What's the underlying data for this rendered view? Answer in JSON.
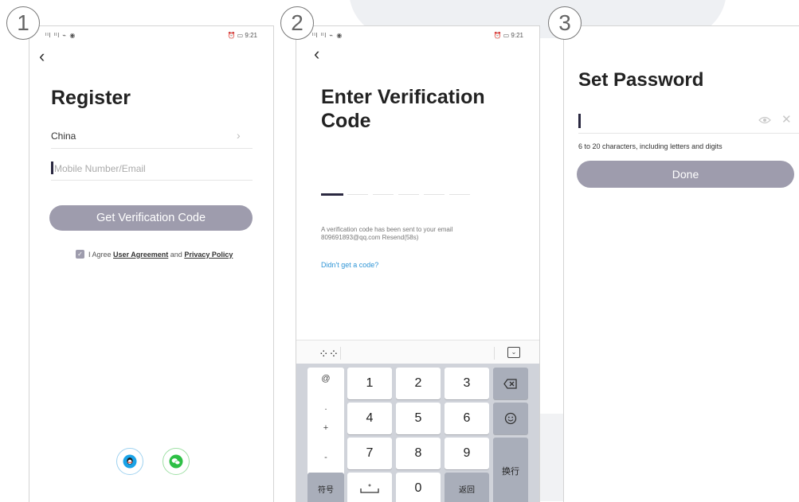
{
  "steps": [
    "1",
    "2",
    "3"
  ],
  "status": {
    "left": "ᴵᴵl ᴵᴵl ⌁ ◉",
    "right": "⏰ ▭ 9:21"
  },
  "screen1": {
    "title": "Register",
    "country": "China",
    "input_placeholder": "Mobile Number/Email",
    "button": "Get Verification Code",
    "agree_prefix": "I Agree",
    "user_agreement": "User Agreement",
    "and": "and",
    "privacy_policy": "Privacy Policy",
    "social": [
      "qq-icon",
      "wechat-icon"
    ]
  },
  "screen2": {
    "title_line1": "Enter Verification",
    "title_line2": "Code",
    "sent_line1": "A verification code has been sent to your email",
    "sent_line2": "809691893@qq.com  Resend(58s)",
    "didnt_get": "Didn't get a code?",
    "keys": {
      "row1": [
        "1",
        "2",
        "3"
      ],
      "row2": [
        "4",
        "5",
        "6"
      ],
      "row3": [
        "7",
        "8",
        "9"
      ],
      "zero": "0",
      "sym_column": [
        "@",
        ".",
        "+",
        "-"
      ],
      "fuhao": "符号",
      "fanhui": "返回",
      "huanhang": "换行"
    }
  },
  "screen3": {
    "title": "Set Password",
    "hint": "6 to 20 characters, including letters and digits",
    "button": "Done"
  },
  "colors": {
    "accent": "#9e9cad",
    "caret": "#2a2840",
    "link": "#2f95d6"
  }
}
